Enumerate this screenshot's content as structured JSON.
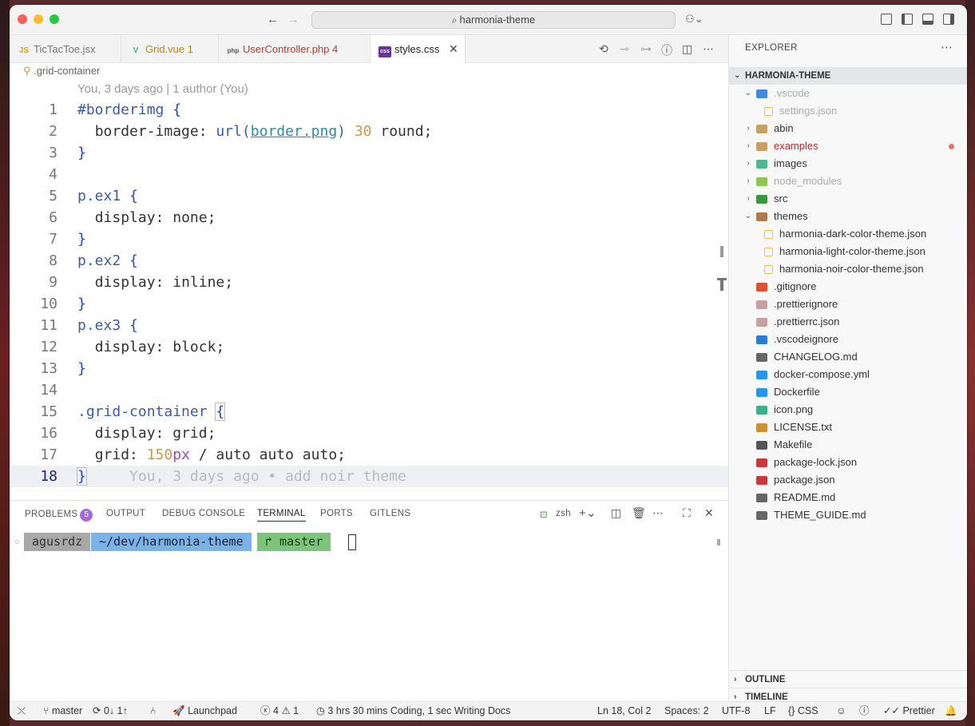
{
  "window": {
    "title": "harmonia-theme"
  },
  "tabs": [
    {
      "label": "TicTacToe.jsx",
      "icon": "JS",
      "color": "#c9a227",
      "badge": "",
      "active": false
    },
    {
      "label": "Grid.vue",
      "icon": "V",
      "color": "#b8860b",
      "badge": "1",
      "active": false
    },
    {
      "label": "UserController.php",
      "icon": "php",
      "color": "#c0392b",
      "badge": "4",
      "active": false
    },
    {
      "label": "styles.css",
      "icon": "css",
      "color": "#222",
      "badge": "",
      "active": true
    }
  ],
  "breadcrumb": ".grid-container",
  "blame": {
    "header": "You, 3 days ago | 1 author (You)",
    "inline": "You, 3 days ago • add noir theme"
  },
  "editor": {
    "line_numbers": [
      "1",
      "2",
      "3",
      "4",
      "5",
      "6",
      "7",
      "8",
      "9",
      "10",
      "11",
      "12",
      "13",
      "14",
      "15",
      "16",
      "17",
      "18"
    ],
    "current_line": 18
  },
  "panel": {
    "tabs": {
      "problems": "PROBLEMS",
      "problems_count": "5",
      "output": "OUTPUT",
      "debug": "DEBUG CONSOLE",
      "terminal": "TERMINAL",
      "ports": "PORTS",
      "gitlens": "GITLENS"
    },
    "shell": "zsh",
    "prompt": {
      "user": "agusrdz",
      "path": "~/dev/harmonia-theme",
      "branch": "↱ master"
    }
  },
  "explorer": {
    "title": "EXPLORER",
    "root": "HARMONIA-THEME",
    "items": [
      {
        "label": ".vscode",
        "type": "folder-open",
        "depth": 1,
        "color": "#aaa",
        "icon": "vscode-folder-icon"
      },
      {
        "label": "settings.json",
        "type": "file",
        "depth": 2,
        "color": "#aaa",
        "icon": "json-icon"
      },
      {
        "label": "abin",
        "type": "folder",
        "depth": 1,
        "color": "#333",
        "icon": "folder-icon"
      },
      {
        "label": "examples",
        "type": "folder",
        "depth": 1,
        "color": "#c62828",
        "icon": "folder-icon"
      },
      {
        "label": "images",
        "type": "folder",
        "depth": 1,
        "color": "#333",
        "icon": "images-folder-icon"
      },
      {
        "label": "node_modules",
        "type": "folder",
        "depth": 1,
        "color": "#aaa",
        "icon": "node-folder-icon"
      },
      {
        "label": "src",
        "type": "folder",
        "depth": 1,
        "color": "#333",
        "icon": "src-folder-icon"
      },
      {
        "label": "themes",
        "type": "folder-open",
        "depth": 1,
        "color": "#333",
        "icon": "themes-folder-icon"
      },
      {
        "label": "harmonia-dark-color-theme.json",
        "type": "file",
        "depth": 2,
        "color": "#333",
        "icon": "json-icon"
      },
      {
        "label": "harmonia-light-color-theme.json",
        "type": "file",
        "depth": 2,
        "color": "#333",
        "icon": "json-icon"
      },
      {
        "label": "harmonia-noir-color-theme.json",
        "type": "file",
        "depth": 2,
        "color": "#333",
        "icon": "json-icon"
      },
      {
        "label": ".gitignore",
        "type": "file",
        "depth": 1,
        "color": "#333",
        "icon": "git-icon"
      },
      {
        "label": ".prettierignore",
        "type": "file",
        "depth": 1,
        "color": "#333",
        "icon": "prettier-icon"
      },
      {
        "label": ".prettierrc.json",
        "type": "file",
        "depth": 1,
        "color": "#333",
        "icon": "prettier-icon"
      },
      {
        "label": ".vscodeignore",
        "type": "file",
        "depth": 1,
        "color": "#333",
        "icon": "vscode-icon"
      },
      {
        "label": "CHANGELOG.md",
        "type": "file",
        "depth": 1,
        "color": "#333",
        "icon": "markdown-icon"
      },
      {
        "label": "docker-compose.yml",
        "type": "file",
        "depth": 1,
        "color": "#333",
        "icon": "docker-icon"
      },
      {
        "label": "Dockerfile",
        "type": "file",
        "depth": 1,
        "color": "#333",
        "icon": "docker-icon"
      },
      {
        "label": "icon.png",
        "type": "file",
        "depth": 1,
        "color": "#333",
        "icon": "image-icon"
      },
      {
        "label": "LICENSE.txt",
        "type": "file",
        "depth": 1,
        "color": "#333",
        "icon": "license-icon"
      },
      {
        "label": "Makefile",
        "type": "file",
        "depth": 1,
        "color": "#333",
        "icon": "makefile-icon"
      },
      {
        "label": "package-lock.json",
        "type": "file",
        "depth": 1,
        "color": "#333",
        "icon": "npm-icon"
      },
      {
        "label": "package.json",
        "type": "file",
        "depth": 1,
        "color": "#333",
        "icon": "npm-icon"
      },
      {
        "label": "README.md",
        "type": "file",
        "depth": 1,
        "color": "#333",
        "icon": "markdown-icon"
      },
      {
        "label": "THEME_GUIDE.md",
        "type": "file",
        "depth": 1,
        "color": "#333",
        "icon": "markdown-icon"
      }
    ],
    "outline": "OUTLINE",
    "timeline": "TIMELINE"
  },
  "status": {
    "branch": "master",
    "sync": "0↓ 1↑",
    "launchpad": "Launchpad",
    "errors": "4",
    "warnings": "1",
    "coding": "3 hrs 30 mins Coding, 1 sec Writing Docs",
    "position": "Ln 18, Col 2",
    "spaces": "Spaces: 2",
    "encoding": "UTF-8",
    "eol": "LF",
    "language": "CSS",
    "prettier": "Prettier"
  },
  "colors": {
    "accent": "#a46ad8",
    "dirty": "#e57373"
  }
}
